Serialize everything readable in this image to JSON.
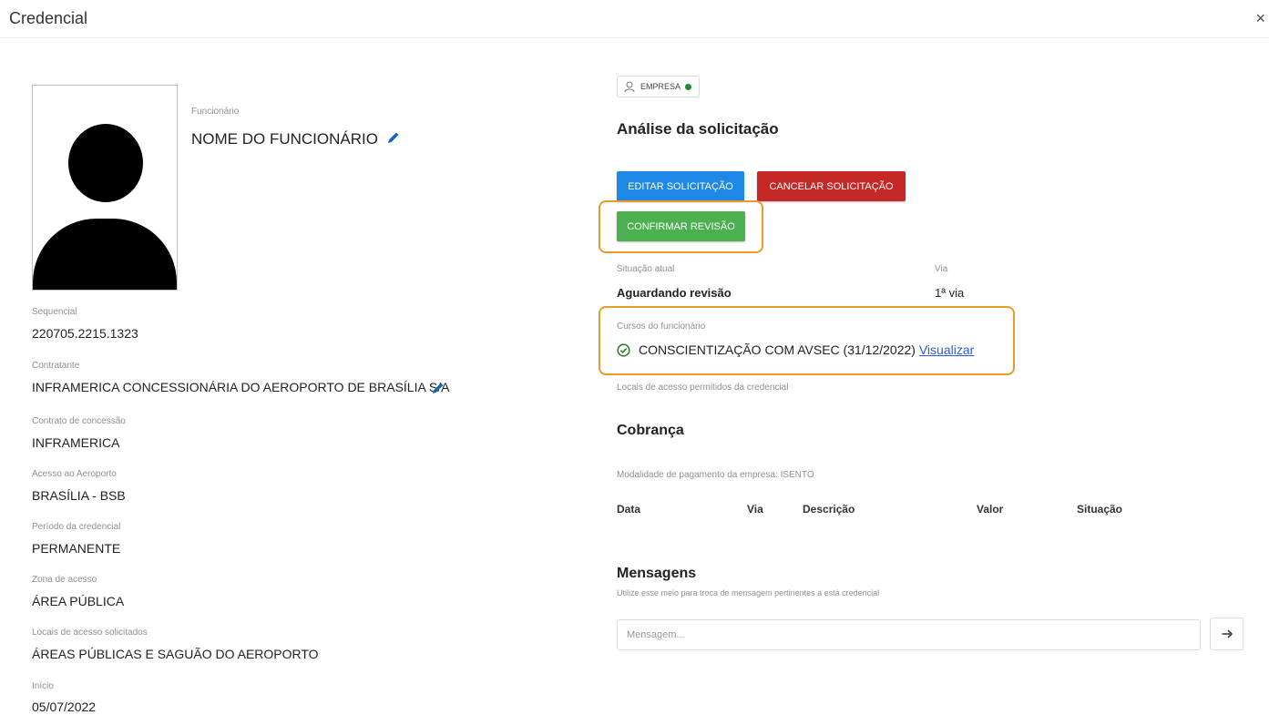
{
  "header": {
    "title": "Credencial",
    "close": "×"
  },
  "employee": {
    "label": "Funcionário",
    "name": "NOME DO FUNCIONÁRIO"
  },
  "fields": [
    {
      "label": "Sequencial",
      "value": "220705.2215.1323"
    },
    {
      "label": "Contratante",
      "value": "INFRAMERICA CONCESSIONÁRIA DO AEROPORTO DE BRASÍLIA S/A"
    },
    {
      "label": "Contrato de concessão",
      "value": "INFRAMERICA"
    },
    {
      "label": "Acesso ao Aeroporto",
      "value": "BRASÍLIA - BSB"
    },
    {
      "label": "Período da credencial",
      "value": "PERMANENTE"
    },
    {
      "label": "Zona de acesso",
      "value": "ÁREA PÚBLICA"
    },
    {
      "label": "Locais de acesso solicitados",
      "value": "ÁREAS PÚBLICAS E SAGUÃO DO AEROPORTO"
    },
    {
      "label": "Início",
      "value": "05/07/2022"
    }
  ],
  "company_chip": {
    "label": "EMPRESA",
    "status_color": "#1f8a3a"
  },
  "analysis": {
    "title": "Análise da solicitação",
    "edit_button": "EDITAR SOLICITAÇÃO",
    "cancel_button": "CANCELAR SOLICITAÇÃO",
    "confirm_button": "CONFIRMAR REVISÃO",
    "status_label": "Situação atual",
    "status_value": "Aguardando revisão",
    "via_label": "Via",
    "via_value": "1ª via",
    "courses_label": "Cursos do funcionário",
    "course_text": "CONSCIENTIZAÇÃO COM AVSEC (31/12/2022)",
    "course_link": "Visualizar",
    "allowed_places_label": "Locais de acesso permitidos da credencial"
  },
  "billing": {
    "title": "Cobrança",
    "payment_mode": "Modalidade de pagamento da empresa: ISENTO",
    "columns": [
      "Data",
      "Via",
      "Descrição",
      "Valor",
      "Situação"
    ]
  },
  "messages": {
    "title": "Mensagens",
    "subtitle": "Utilize esse meio para troca de mensagem pertinentes a está credencial",
    "placeholder": "Mensagem..."
  },
  "colors": {
    "edit": "#1e88e5",
    "cancel": "#c62828",
    "confirm": "#4caf50",
    "highlight": "#e99a2b",
    "link": "#2f5bd6"
  },
  "icons": {
    "pencil": "pencil-icon",
    "user": "user-icon",
    "check": "check-circle-icon",
    "send": "arrow-right-icon",
    "close": "close-icon"
  }
}
